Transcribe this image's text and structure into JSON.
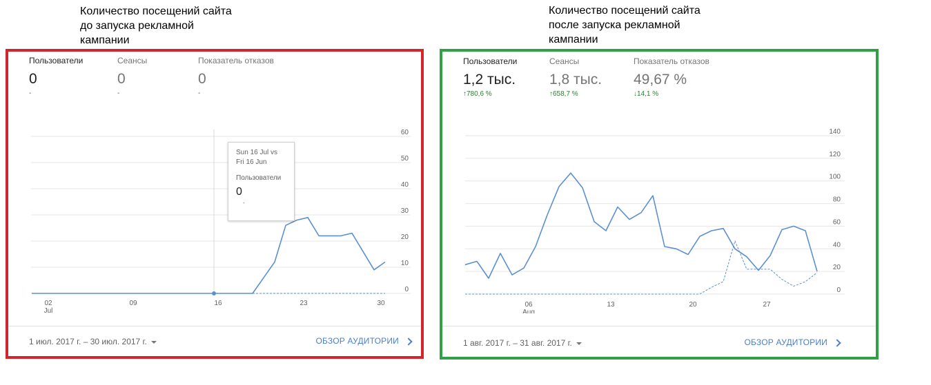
{
  "captions": {
    "left": "Количество посещений сайта\nдо запуска рекламной\nкампании",
    "right": "Количество посещений сайта\nпосле запуска рекламной\nкампании"
  },
  "colors": {
    "left_frame": "#d2262e",
    "right_frame": "#2fa046",
    "line": "#5b8fd0",
    "link": "#4a7fc9",
    "up": "#2e7d32"
  },
  "left_panel": {
    "metrics": [
      {
        "label": "Пользователи",
        "value": "0",
        "delta": "-"
      },
      {
        "label": "Сеансы",
        "value": "0",
        "delta": "-"
      },
      {
        "label": "Показатель отказов",
        "value": "0",
        "delta": "-"
      }
    ],
    "tooltip": {
      "date": "Sun 16 Jul vs\nFri 16 Jun",
      "label": "Пользователи",
      "value": "0",
      "delta": "-"
    },
    "date_range": "1 июл. 2017 г. – 30 июл. 2017 г.",
    "overview_link": "ОБЗОР АУДИТОРИИ"
  },
  "right_panel": {
    "metrics": [
      {
        "label": "Пользователи",
        "value": "1,2 тыс.",
        "delta": "780,6 %",
        "direction": "up"
      },
      {
        "label": "Сеансы",
        "value": "1,8 тыс.",
        "delta": "658,7 %",
        "direction": "up"
      },
      {
        "label": "Показатель отказов",
        "value": "49,67 %",
        "delta": "14,1 %",
        "direction": "down"
      }
    ],
    "date_range": "1 авг. 2017 г. – 31 авг. 2017 г.",
    "overview_link": "ОБЗОР АУДИТОРИИ"
  },
  "chart_data": [
    {
      "type": "line",
      "x_ticks": [
        "02",
        "09",
        "16",
        "23",
        "30"
      ],
      "x_tick_month": "Jul",
      "y_ticks": [
        0,
        10,
        20,
        30,
        40,
        50,
        60
      ],
      "ylim": [
        0,
        60
      ],
      "x": [
        1,
        2,
        3,
        4,
        5,
        6,
        7,
        8,
        9,
        10,
        11,
        12,
        13,
        14,
        15,
        16,
        17,
        18,
        19,
        20,
        21,
        22,
        23,
        24,
        25,
        26,
        27,
        28,
        29,
        30,
        31
      ],
      "series": [
        {
          "values": [
            0,
            0,
            0,
            0,
            0,
            0,
            0,
            0,
            0,
            0,
            0,
            0,
            0,
            0,
            0,
            0,
            0,
            0,
            0,
            0,
            0,
            6,
            12,
            26,
            28,
            29,
            22,
            22,
            22,
            23,
            16,
            9,
            12
          ]
        },
        {
          "style": "dashed",
          "values": [
            0,
            0,
            0,
            0,
            0,
            0,
            0,
            0,
            0,
            0,
            0,
            0,
            0,
            0,
            0,
            0,
            0,
            0,
            0,
            0,
            0,
            0,
            0,
            0,
            0,
            0,
            0,
            0,
            0,
            0,
            0,
            0,
            0
          ]
        }
      ],
      "highlight_x": 16
    },
    {
      "type": "line",
      "x_ticks": [
        "06",
        "13",
        "20",
        "27"
      ],
      "x_tick_month": "Aug",
      "y_ticks": [
        0,
        20,
        40,
        60,
        80,
        100,
        120,
        140
      ],
      "ylim": [
        0,
        140
      ],
      "series": [
        {
          "values": [
            26,
            29,
            14,
            36,
            17,
            23,
            42,
            70,
            95,
            107,
            94,
            64,
            56,
            77,
            66,
            72,
            87,
            42,
            40,
            35,
            51,
            56,
            58,
            40,
            33,
            21,
            34,
            57,
            60,
            56,
            20
          ]
        },
        {
          "style": "dashed",
          "values": [
            0,
            0,
            0,
            0,
            0,
            0,
            0,
            0,
            0,
            0,
            0,
            0,
            0,
            0,
            0,
            0,
            0,
            0,
            0,
            0,
            0,
            6,
            11,
            47,
            22,
            22,
            22,
            13,
            7,
            11,
            19
          ]
        }
      ]
    }
  ]
}
